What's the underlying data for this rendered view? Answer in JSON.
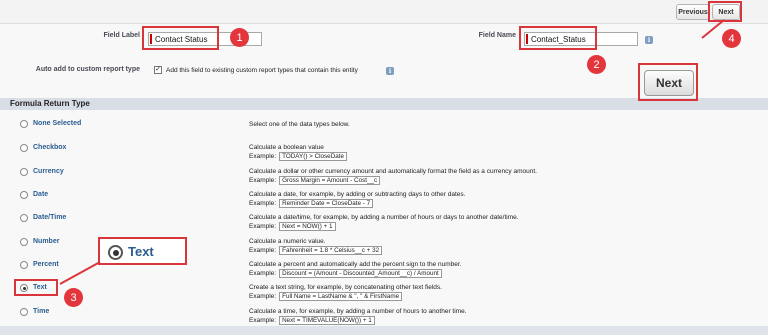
{
  "nav": {
    "previous_label": "Previous",
    "next_label": "Next"
  },
  "fields": {
    "field_label_label": "Field Label",
    "field_label_value": "Contact Status",
    "field_name_label": "Field Name",
    "field_name_value": "Contact_Status",
    "auto_add_label": "Auto add to custom report type",
    "auto_add_text": "Add this field to existing custom report types that contain this entity",
    "auto_add_checked": true,
    "info_icon": "info-icon"
  },
  "section": {
    "title": "Formula Return Type"
  },
  "options": [
    {
      "label": "None Selected",
      "description": "Select one of the data types below.",
      "example_prefix": "",
      "example": "",
      "checked": false
    },
    {
      "label": "Checkbox",
      "description": "Calculate a boolean value",
      "example_prefix": "Example:",
      "example": "TODAY() > CloseDate",
      "checked": false
    },
    {
      "label": "Currency",
      "description": "Calculate a dollar or other currency amount and automatically format the field as a currency amount.",
      "example_prefix": "Example:",
      "example": "Gross Margin = Amount - Cost__c",
      "checked": false
    },
    {
      "label": "Date",
      "description": "Calculate a date, for example, by adding or subtracting days to other dates.",
      "example_prefix": "Example:",
      "example": "Reminder Date = CloseDate - 7",
      "checked": false
    },
    {
      "label": "Date/Time",
      "description": "Calculate a date/time, for example, by adding a number of hours or days to another date/time.",
      "example_prefix": "Example:",
      "example": "Next = NOW() + 1",
      "checked": false
    },
    {
      "label": "Number",
      "description": "Calculate a numeric value.",
      "example_prefix": "Example:",
      "example": "Fahrenheit = 1.8 * Celsius__c + 32",
      "checked": false
    },
    {
      "label": "Percent",
      "description": "Calculate a percent and automatically add the percent sign to the number.",
      "example_prefix": "Example:",
      "example": "Discount = (Amount - Discounted_Amount__c) / Amount",
      "checked": false
    },
    {
      "label": "Text",
      "description": "Create a text string, for example, by concatenating other text fields.",
      "example_prefix": "Example:",
      "example": "Full Name = LastName & \", \" & FirstName",
      "checked": true
    },
    {
      "label": "Time",
      "description": "Calculate a time, for example, by adding a number of hours to another time.",
      "example_prefix": "Example:",
      "example": "Next = TIMEVALUE(NOW()) + 1",
      "checked": false
    }
  ],
  "annotations": {
    "badge_1": "1",
    "badge_2": "2",
    "badge_3": "3",
    "badge_4": "4",
    "zoom_next_label": "Next",
    "zoom_text_label": "Text",
    "accent_color": "#d9353b"
  }
}
